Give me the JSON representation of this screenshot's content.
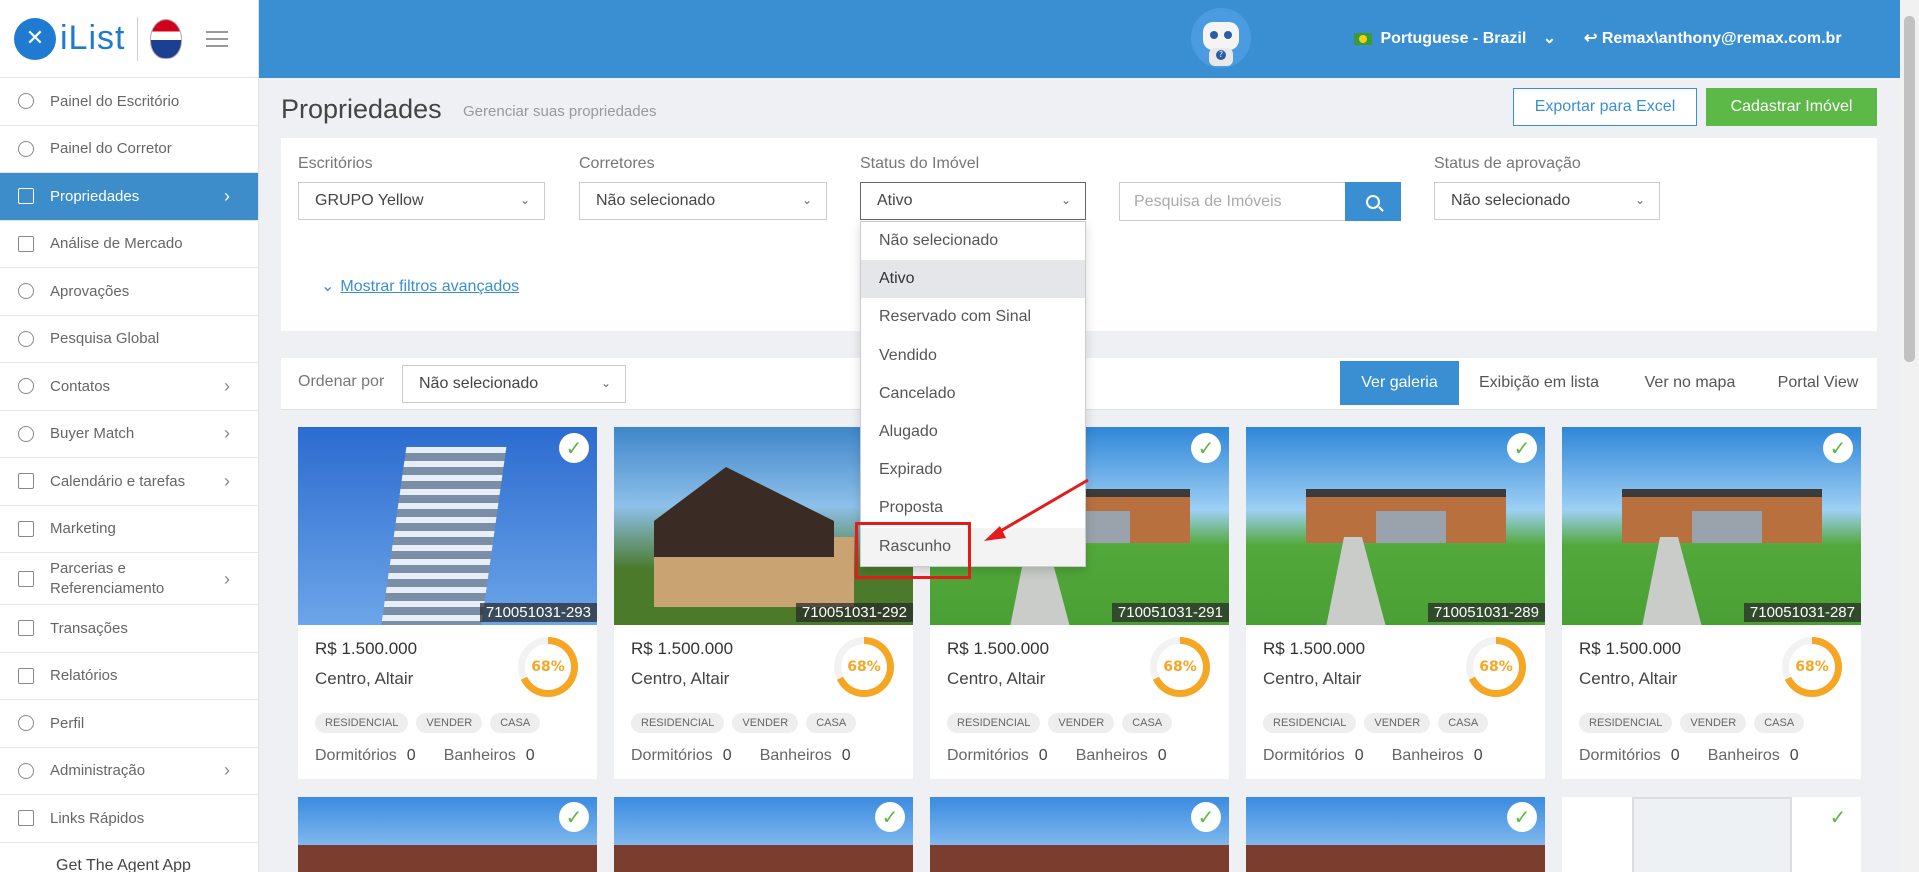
{
  "app": {
    "name": "iList"
  },
  "sidebar": {
    "items": [
      {
        "label": "Painel do Escritório",
        "icon": "gauge-icon",
        "chevron": false
      },
      {
        "label": "Painel do Corretor",
        "icon": "gauge-icon",
        "chevron": false
      },
      {
        "label": "Propriedades",
        "icon": "home-icon",
        "chevron": true,
        "active": true
      },
      {
        "label": "Análise de Mercado",
        "icon": "bar-chart-icon",
        "chevron": false
      },
      {
        "label": "Aprovações",
        "icon": "eye-icon",
        "chevron": false
      },
      {
        "label": "Pesquisa Global",
        "icon": "search-icon",
        "chevron": false
      },
      {
        "label": "Contatos",
        "icon": "contacts-icon",
        "chevron": true
      },
      {
        "label": "Buyer Match",
        "icon": "user-icon",
        "chevron": true
      },
      {
        "label": "Calendário e tarefas",
        "icon": "calendar-icon",
        "chevron": true
      },
      {
        "label": "Marketing",
        "icon": "book-icon",
        "chevron": false
      },
      {
        "label": "Parcerias e Referenciamento",
        "icon": "handshake-icon",
        "chevron": true
      },
      {
        "label": "Transações",
        "icon": "briefcase-icon",
        "chevron": false
      },
      {
        "label": "Relatórios",
        "icon": "bar-chart-icon",
        "chevron": false
      },
      {
        "label": "Perfil",
        "icon": "user-icon",
        "chevron": false
      },
      {
        "label": "Administração",
        "icon": "gear-icon",
        "chevron": true
      },
      {
        "label": "Links Rápidos",
        "icon": "link-icon",
        "chevron": false
      }
    ],
    "footer": "Get The Agent App"
  },
  "topbar": {
    "language": "Portuguese - Brazil",
    "user": "Remax\\anthony@remax.com.br"
  },
  "page": {
    "title": "Propriedades",
    "subtitle": "Gerenciar suas propriedades",
    "export_label": "Exportar para Excel",
    "create_label": "Cadastrar Imóvel"
  },
  "filters": {
    "offices_label": "Escritórios",
    "offices_value": "GRUPO Yellow",
    "agents_label": "Corretores",
    "agents_value": "Não selecionado",
    "status_label": "Status do Imóvel",
    "status_value": "Ativo",
    "search_placeholder": "Pesquisa de Imóveis",
    "approval_label": "Status de aprovação",
    "approval_value": "Não selecionado",
    "advanced_label": "Mostrar filtros avançados"
  },
  "status_dropdown": {
    "options": [
      "Não selecionado",
      "Ativo",
      "Reservado com Sinal",
      "Vendido",
      "Cancelado",
      "Alugado",
      "Expirado",
      "Proposta",
      "Rascunho"
    ],
    "selected": "Ativo",
    "highlighted": "Rascunho",
    "annotation_color": "#e41b1b"
  },
  "toolbar": {
    "sort_label": "Ordenar por",
    "sort_value": "Não selecionado",
    "views": [
      "Ver galeria",
      "Exibição em lista",
      "Ver no mapa",
      "Portal View"
    ],
    "active_view": "Ver galeria"
  },
  "cards": [
    {
      "code": "710051031-293",
      "price": "R$ 1.500.000",
      "location": "Centro, Altair",
      "score": "68%",
      "tags": [
        "RESIDENCIAL",
        "VENDER",
        "CASA"
      ],
      "bedrooms_label": "Dormitórios",
      "bedrooms": "0",
      "baths_label": "Banheiros",
      "baths": "0",
      "image": "building"
    },
    {
      "code": "710051031-292",
      "price": "R$ 1.500.000",
      "location": "Centro, Altair",
      "score": "68%",
      "tags": [
        "RESIDENCIAL",
        "VENDER",
        "CASA"
      ],
      "bedrooms_label": "Dormitórios",
      "bedrooms": "0",
      "baths_label": "Banheiros",
      "baths": "0",
      "image": "house-construction"
    },
    {
      "code": "710051031-291",
      "price": "R$ 1.500.000",
      "location": "Centro, Altair",
      "score": "68%",
      "tags": [
        "RESIDENCIAL",
        "VENDER",
        "CASA"
      ],
      "bedrooms_label": "Dormitórios",
      "bedrooms": "0",
      "baths_label": "Banheiros",
      "baths": "0",
      "image": "modern-house"
    },
    {
      "code": "710051031-289",
      "price": "R$ 1.500.000",
      "location": "Centro, Altair",
      "score": "68%",
      "tags": [
        "RESIDENCIAL",
        "VENDER",
        "CASA"
      ],
      "bedrooms_label": "Dormitórios",
      "bedrooms": "0",
      "baths_label": "Banheiros",
      "baths": "0",
      "image": "modern-house"
    },
    {
      "code": "710051031-287",
      "price": "R$ 1.500.000",
      "location": "Centro, Altair",
      "score": "68%",
      "tags": [
        "RESIDENCIAL",
        "VENDER",
        "CASA"
      ],
      "bedrooms_label": "Dormitórios",
      "bedrooms": "0",
      "baths_label": "Banheiros",
      "baths": "0",
      "image": "modern-house"
    }
  ],
  "colors": {
    "primary": "#3a8fd3",
    "success": "#5cb847",
    "score": "#f5a623",
    "active_nav": "#3c8dc9"
  }
}
